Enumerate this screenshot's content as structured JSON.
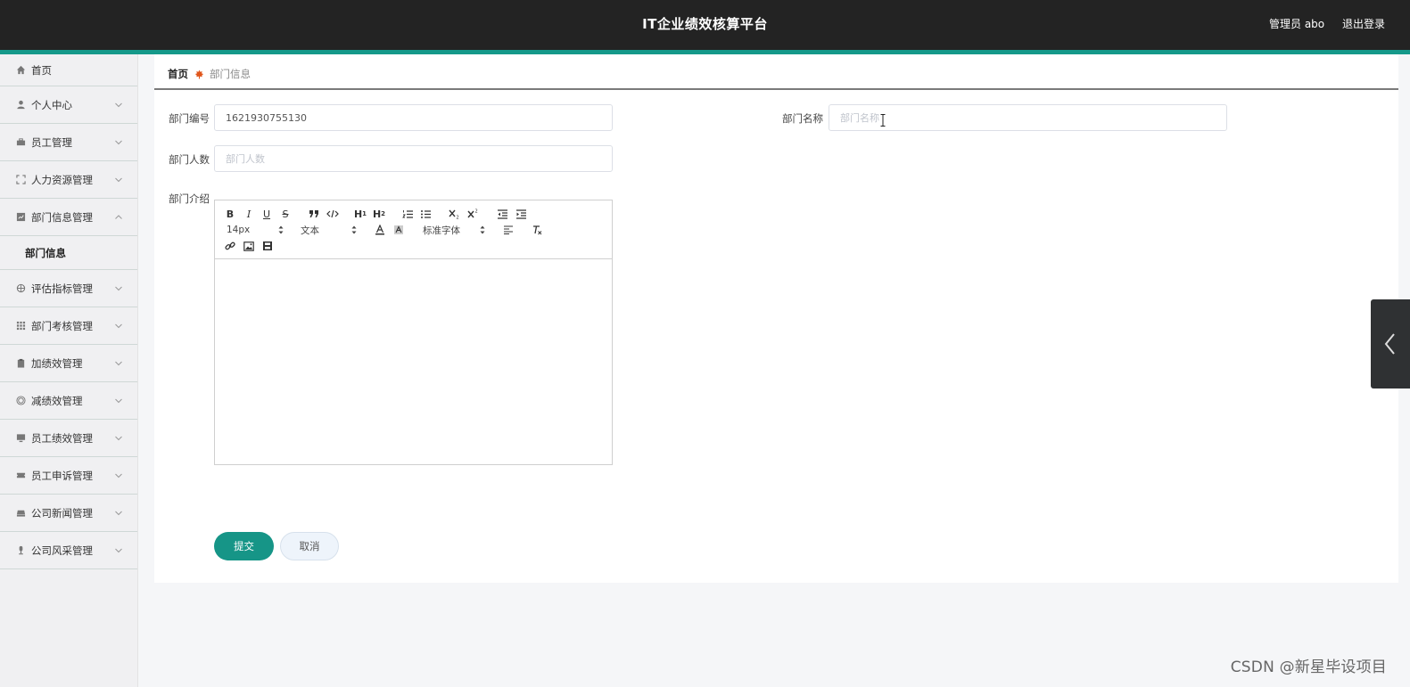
{
  "header": {
    "title": "IT企业绩效核算平台",
    "user_label": "管理员 abo",
    "logout_label": "退出登录"
  },
  "sidebar": {
    "items": [
      {
        "label": "首页",
        "icon": "home-icon"
      },
      {
        "label": "个人中心",
        "icon": "user-icon"
      },
      {
        "label": "员工管理",
        "icon": "briefcase-icon"
      },
      {
        "label": "人力资源管理",
        "icon": "expand-icon"
      },
      {
        "label": "部门信息管理",
        "icon": "chart-icon"
      },
      {
        "label": "评估指标管理",
        "icon": "aperture-icon"
      },
      {
        "label": "部门考核管理",
        "icon": "grid-icon"
      },
      {
        "label": "加绩效管理",
        "icon": "clipboard-icon"
      },
      {
        "label": "减绩效管理",
        "icon": "target-icon"
      },
      {
        "label": "员工绩效管理",
        "icon": "monitor-icon"
      },
      {
        "label": "员工申诉管理",
        "icon": "ticket-icon"
      },
      {
        "label": "公司新闻管理",
        "icon": "news-icon"
      },
      {
        "label": "公司风采管理",
        "icon": "award-icon"
      }
    ],
    "submenu": {
      "label": "部门信息"
    }
  },
  "breadcrumb": {
    "home": "首页",
    "current": "部门信息"
  },
  "form": {
    "dept_no": {
      "label": "部门编号",
      "value": "1621930755130"
    },
    "dept_name": {
      "label": "部门名称",
      "placeholder": "部门名称"
    },
    "dept_count": {
      "label": "部门人数",
      "placeholder": "部门人数"
    },
    "dept_intro": {
      "label": "部门介绍"
    }
  },
  "editor": {
    "size_option": "14px",
    "header_option": "文本",
    "font_option": "标准字体"
  },
  "buttons": {
    "submit": "提交",
    "cancel": "取消"
  },
  "watermark": "CSDN @新星毕设项目",
  "colors": {
    "header_bg": "#232323",
    "accent": "#15998a",
    "primary_button": "#169587"
  }
}
